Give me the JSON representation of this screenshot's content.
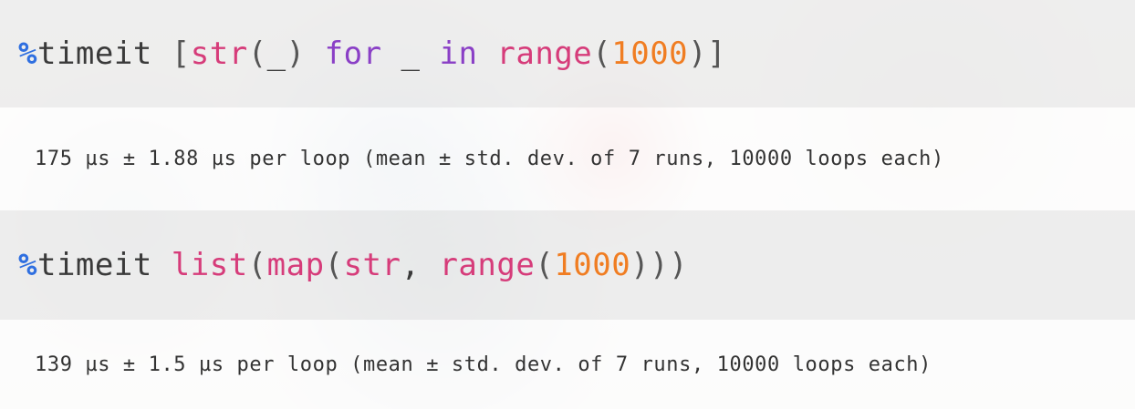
{
  "colors": {
    "magic_percent": "#2f6fe0",
    "builtin": "#d63c7a",
    "keyword": "#8a3fc6",
    "number": "#f07d22",
    "plain": "#3a3a3a",
    "input_cell_bg": "#ececec",
    "output_cell_bg": "#ffffff"
  },
  "cells": [
    {
      "input": {
        "tokens": [
          "%",
          "timeit ",
          "[",
          "str",
          "(",
          "_",
          ")",
          " ",
          "for",
          " _ ",
          "in",
          " ",
          "range",
          "(",
          "1000",
          ")",
          "]"
        ]
      },
      "output": "175 µs ± 1.88 µs per loop (mean ± std. dev. of 7 runs, 10000 loops each)"
    },
    {
      "input": {
        "tokens": [
          "%",
          "timeit ",
          "list",
          "(",
          "map",
          "(",
          "str",
          ", ",
          "range",
          "(",
          "1000",
          ")))"
        ]
      },
      "output": "139 µs ± 1.5 µs per loop (mean ± std. dev. of 7 runs, 10000 loops each)"
    }
  ]
}
